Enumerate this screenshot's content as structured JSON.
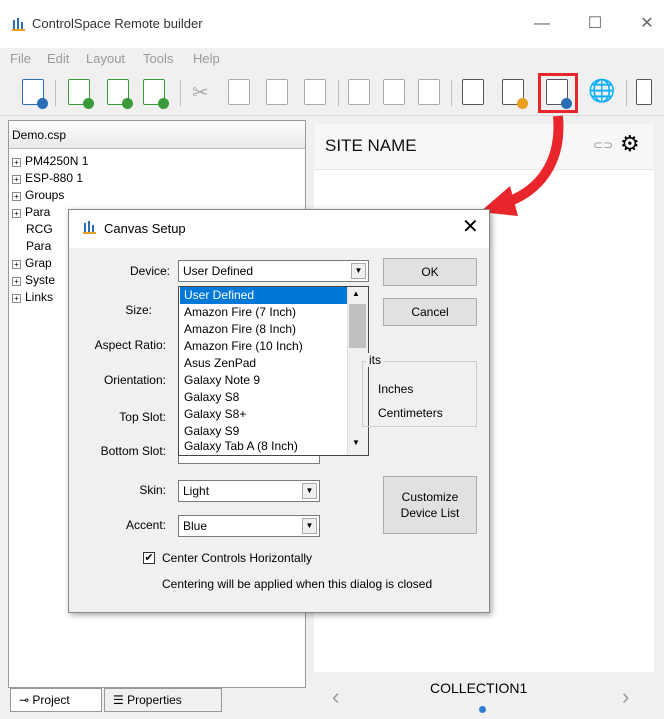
{
  "window": {
    "title": "ControlSpace Remote builder",
    "minimize": "—",
    "maximize": "☐",
    "close": "✕"
  },
  "menu": [
    "File",
    "Edit",
    "Layout",
    "Tools",
    "Help"
  ],
  "project_tree": {
    "header": "Demo.csp",
    "items": [
      {
        "label": "PM4250N 1",
        "expandable": true
      },
      {
        "label": "ESP-880 1",
        "expandable": true
      },
      {
        "label": "Groups",
        "expandable": true
      },
      {
        "label": "Para",
        "expandable": true
      },
      {
        "label": "RCG",
        "expandable": false
      },
      {
        "label": "Para",
        "expandable": false
      },
      {
        "label": "Grap",
        "expandable": true
      },
      {
        "label": "Syste",
        "expandable": true
      },
      {
        "label": "Links",
        "expandable": true
      }
    ]
  },
  "bottom_tabs": {
    "project": "Project",
    "properties": "Properties"
  },
  "preview": {
    "site_name": "SITE NAME",
    "collection": "COLLECTION1",
    "prev_arrow": "‹",
    "next_arrow": "›"
  },
  "dialog": {
    "title": "Canvas Setup",
    "close": "✕",
    "labels": {
      "device": "Device:",
      "size": "Size:",
      "aspect_ratio": "Aspect Ratio:",
      "orientation": "Orientation:",
      "top_slot": "Top Slot:",
      "bottom_slot": "Bottom Slot:",
      "skin": "Skin:",
      "accent": "Accent:"
    },
    "device_value": "User Defined",
    "skin_value": "Light",
    "accent_value": "Blue",
    "ok": "OK",
    "cancel": "Cancel",
    "units_legend": "its",
    "units_inches": "Inches",
    "units_centimeters": "Centimeters",
    "customize_line1": "Customize",
    "customize_line2": "Device List",
    "center_checkbox": "Center Controls Horizontally",
    "center_checked": true,
    "center_note": "Centering will be applied when this dialog is closed",
    "dropdown_options": [
      "User Defined",
      "Amazon Fire (7 Inch)",
      "Amazon Fire (8 Inch)",
      "Amazon Fire (10 Inch)",
      "Asus ZenPad",
      "Galaxy Note 9",
      "Galaxy S8",
      "Galaxy S8+",
      "Galaxy S9",
      "Galaxy Tab A (8 Inch)"
    ],
    "dropdown_selected_index": 0
  },
  "colors": {
    "highlight": "#e8262b",
    "selection": "#0078d7",
    "icon_green": "#3a9a3a",
    "icon_blue": "#2a6fb6"
  }
}
